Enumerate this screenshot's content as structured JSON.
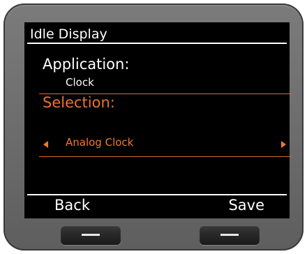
{
  "screen": {
    "title": "Idle Display",
    "application_label": "Application:",
    "application_value": "Clock",
    "selection_label": "Selection:",
    "selection_value": "Analog Clock"
  },
  "softkeys": {
    "left": "Back",
    "right": "Save"
  },
  "colors": {
    "accent": "#f07a2c",
    "background": "#000000",
    "bezel": "#6f6f6f"
  }
}
